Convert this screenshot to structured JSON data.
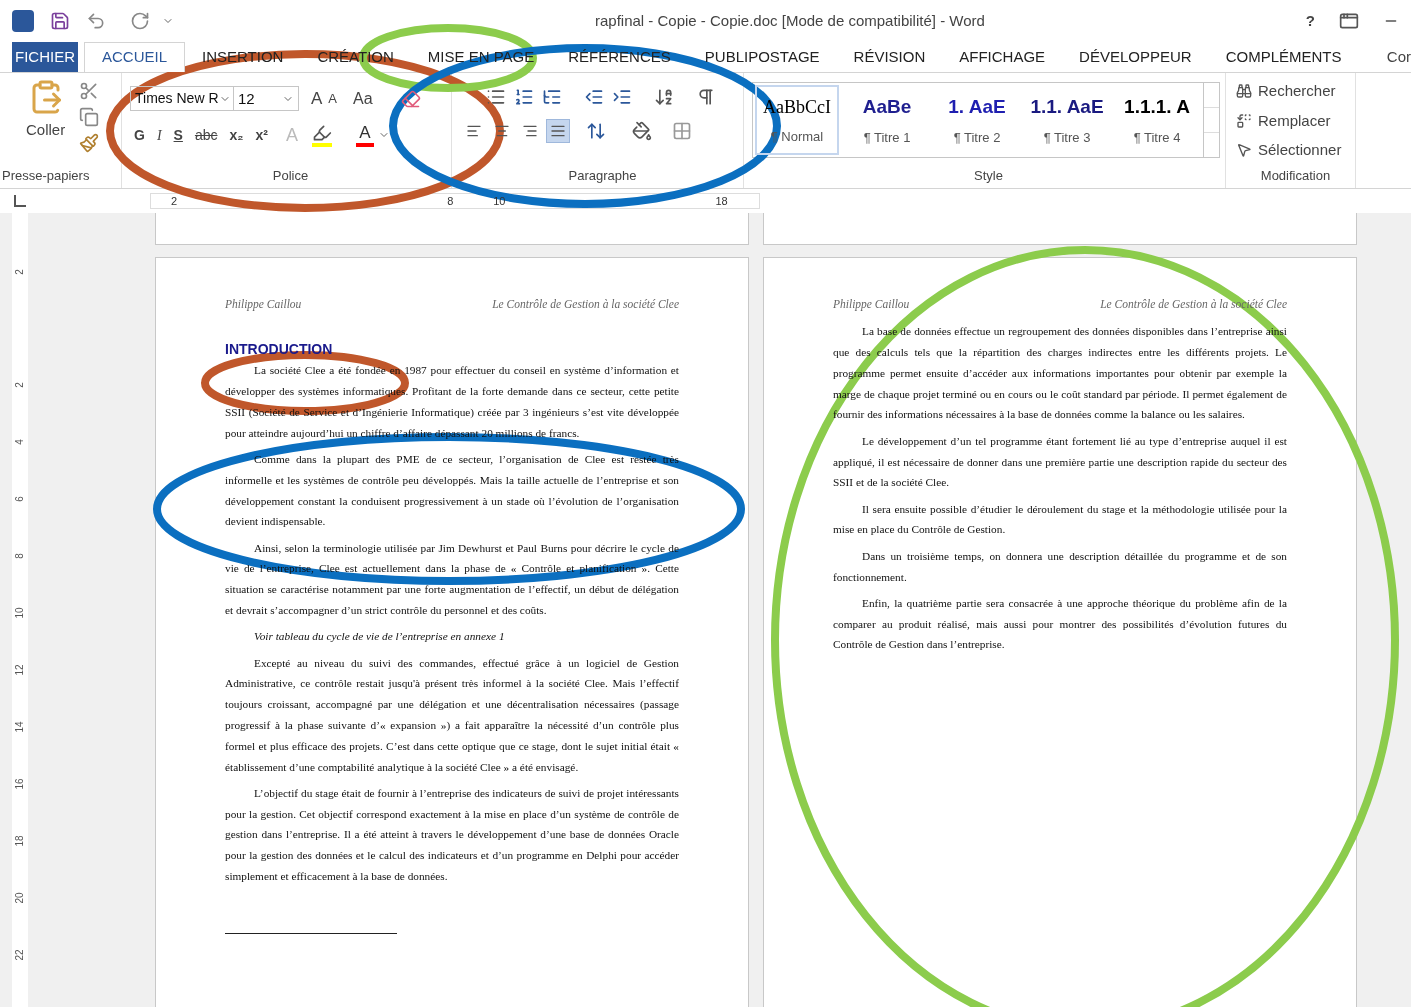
{
  "window": {
    "title": "rapfinal - Copie - Copie.doc [Mode de compatibilité] - Word",
    "help": "?"
  },
  "tabs": [
    {
      "label": "FICHIER",
      "kind": "file",
      "selected": false
    },
    {
      "label": "ACCUEIL",
      "kind": "tab",
      "selected": true
    },
    {
      "label": "INSERTION",
      "kind": "tab",
      "selected": false
    },
    {
      "label": "CRÉATION",
      "kind": "tab",
      "selected": false
    },
    {
      "label": "MISE EN PAGE",
      "kind": "tab",
      "selected": false
    },
    {
      "label": "RÉFÉRENCES",
      "kind": "tab",
      "selected": false
    },
    {
      "label": "PUBLIPOSTAGE",
      "kind": "tab",
      "selected": false
    },
    {
      "label": "RÉVISION",
      "kind": "tab",
      "selected": false
    },
    {
      "label": "AFFICHAGE",
      "kind": "tab",
      "selected": false
    },
    {
      "label": "DÉVELOPPEUR",
      "kind": "tab",
      "selected": false
    },
    {
      "label": "COMPLÉMENTS",
      "kind": "tab",
      "selected": false
    }
  ],
  "account": "Cor",
  "clipboard": {
    "paste": "Coller",
    "group": "Presse-papiers"
  },
  "font": {
    "name": "Times New R",
    "size": "12",
    "grow": "A",
    "shrink": "A",
    "case": "Aa",
    "group": "Police",
    "styles": [
      {
        "label": "G",
        "kind": "bold"
      },
      {
        "label": "I",
        "kind": "italic"
      },
      {
        "label": "S",
        "kind": "underline"
      },
      {
        "label": "abc",
        "kind": "strike"
      },
      {
        "label": "x₂",
        "kind": "sub"
      },
      {
        "label": "x²",
        "kind": "sup"
      }
    ],
    "effects": "A",
    "font_color_label": "A"
  },
  "paragraph": {
    "group": "Paragraphe",
    "alignments": [
      {
        "kind": "left",
        "selected": false
      },
      {
        "kind": "center",
        "selected": false
      },
      {
        "kind": "right",
        "selected": false
      },
      {
        "kind": "justify",
        "selected": true
      }
    ]
  },
  "styles": {
    "group": "Style",
    "items": [
      {
        "preview": "AaBbCcI",
        "name": "¶ Normal",
        "color": "#000000",
        "kind": "normal",
        "selected": true
      },
      {
        "preview": "AaBe",
        "name": "¶ Titre 1",
        "color": "#1f1f8f",
        "kind": "title",
        "selected": false
      },
      {
        "preview": "1. AaE",
        "name": "¶ Titre 2",
        "color": "#1f1fb0",
        "kind": "title",
        "selected": false
      },
      {
        "preview": "1.1. AaE",
        "name": "¶ Titre 3",
        "color": "#1a1a80",
        "kind": "title",
        "selected": false
      },
      {
        "preview": "1.1.1. A",
        "name": "¶ Titre 4",
        "color": "#000000",
        "kind": "title",
        "selected": false
      }
    ]
  },
  "editing": {
    "group": "Modification",
    "items": [
      {
        "label": "Rechercher",
        "kind": "find"
      },
      {
        "label": "Remplacer",
        "kind": "replace"
      },
      {
        "label": "Sélectionner",
        "kind": "select"
      }
    ]
  },
  "ruler": {
    "numbers": [
      "2",
      "8",
      "10",
      "18"
    ]
  },
  "vertical_ruler": {
    "numbers": [
      "2",
      "2",
      "4",
      "6",
      "8",
      "10",
      "12",
      "14",
      "16",
      "18",
      "20",
      "22"
    ]
  },
  "pages": [
    {
      "header_left": "Philippe Caillou",
      "header_right": "Le Contrôle de Gestion à la société Clee",
      "heading": "INTRODUCTION",
      "paragraphs": [
        {
          "kind": "body",
          "text": "La société Clee a été fondée en 1987 pour effectuer du conseil en système d’information et développer des systèmes informatiques. Profitant de la forte demande dans ce secteur, cette petite SSII (Société de Service et d’Ingénierie Informatique) créée par 3 ingénieurs s’est vite développée pour atteindre aujourd’hui un chiffre d’affaire dépassant 20 millions de francs."
        },
        {
          "kind": "body",
          "text": "Comme dans la plupart des PME de ce secteur, l’organisation de Clee est restée très informelle et les systèmes de contrôle peu développés. Mais la taille actuelle de l’entreprise et son développement constant la conduisent progressivement à un stade où l’évolution de l’organisation devient indispensable."
        },
        {
          "kind": "body",
          "text": "Ainsi, selon la terminologie utilisée par Jim Dewhurst et Paul Burns pour décrire le cycle de vie de l’entreprise, Clee est actuellement dans la phase de « Contrôle et planification ». Cette situation se caractérise notamment par une forte augmentation de l’effectif, un début de délégation et devrait s’accompagner d’un strict contrôle du personnel et des coûts."
        },
        {
          "kind": "note",
          "text": "Voir tableau du cycle de vie de l’entreprise en annexe 1"
        },
        {
          "kind": "body",
          "text": "Excepté au niveau du suivi des commandes, effectué grâce à un logiciel de Gestion Administrative, ce contrôle restait jusqu'à présent très informel à la société Clee. Mais l’effectif toujours croissant, accompagné par une délégation et une décentralisation nécessaires (passage progressif à la phase suivante d’« expansion ») a fait apparaître la nécessité d’un contrôle plus formel et plus efficace des projets. C’est dans cette optique que ce stage, dont le sujet initial était « établissement d’une comptabilité analytique à la société Clee » a été envisagé."
        },
        {
          "kind": "body",
          "text": "L’objectif du stage était de fournir à l’entreprise des indicateurs de suivi de projet intéressants pour la gestion. Cet objectif correspond exactement à la mise en place d’un système de contrôle de gestion dans l’entreprise. Il a été atteint à travers le développement d’une base de données Oracle pour la gestion des données et le calcul des indicateurs et d’un programme en Delphi pour accéder simplement et efficacement à la base de données."
        }
      ]
    },
    {
      "header_left": "Philippe Caillou",
      "header_right": "Le Contrôle de Gestion à la société Clee",
      "paragraphs": [
        {
          "kind": "body",
          "text": "La base de données effectue un regroupement des données disponibles dans l’entreprise ainsi que des calculs tels que la répartition des charges indirectes entre les différents projets. Le programme permet ensuite d’accéder aux informations importantes pour obtenir par exemple la marge de chaque projet terminé ou en cours ou le coût standard par période. Il permet également de fournir des informations nécessaires à la base de données comme la balance ou les salaires."
        },
        {
          "kind": "body",
          "text": "Le développement d’un tel programme étant fortement lié au type d’entreprise auquel il est appliqué, il est nécessaire de donner dans une première partie une description rapide du secteur des SSII et de la société Clee."
        },
        {
          "kind": "body",
          "text": "Il sera ensuite possible d’étudier le déroulement du stage et la méthodologie utilisée pour la mise en place du Contrôle de Gestion."
        },
        {
          "kind": "body",
          "text": "Dans un troisième temps, on donnera une description détaillée du programme et de son fonctionnement."
        },
        {
          "kind": "body",
          "text": "Enfin, la quatrième partie sera consacrée à une approche théorique du problème afin de la comparer au produit réalisé, mais aussi pour montrer des possibilités d’évolution futures du Contrôle de Gestion dans l’entreprise."
        }
      ]
    }
  ],
  "annotations": [
    {
      "color": "#c0572b"
    },
    {
      "color": "#8ccc4c"
    },
    {
      "color": "#0b6fc0"
    },
    {
      "color": "#c0572b"
    },
    {
      "color": "#0b6fc0"
    },
    {
      "color": "#8ccc4c"
    }
  ]
}
